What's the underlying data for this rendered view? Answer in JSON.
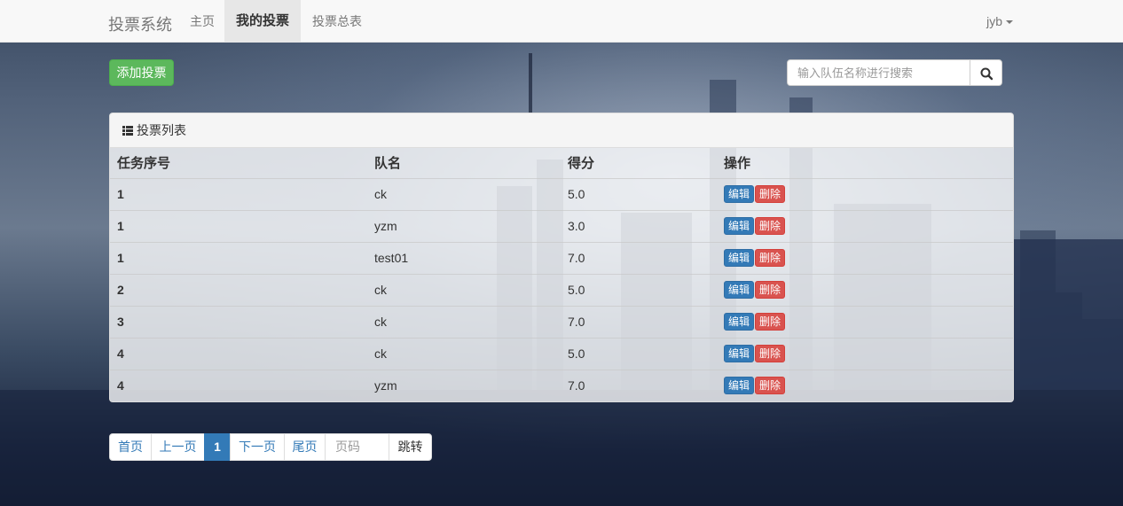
{
  "navbar": {
    "brand": "投票系统",
    "links": [
      "主页",
      "我的投票",
      "投票总表"
    ],
    "user": "jyb"
  },
  "toolbar": {
    "add_label": "添加投票",
    "search_placeholder": "输入队伍名称进行搜索"
  },
  "panel": {
    "title": "投票列表",
    "columns": [
      "任务序号",
      "队名",
      "得分",
      "操作"
    ],
    "rows": [
      {
        "seq": "1",
        "team": "ck",
        "score": "5.0"
      },
      {
        "seq": "1",
        "team": "yzm",
        "score": "3.0"
      },
      {
        "seq": "1",
        "team": "test01",
        "score": "7.0"
      },
      {
        "seq": "2",
        "team": "ck",
        "score": "5.0"
      },
      {
        "seq": "3",
        "team": "ck",
        "score": "7.0"
      },
      {
        "seq": "4",
        "team": "ck",
        "score": "5.0"
      },
      {
        "seq": "4",
        "team": "yzm",
        "score": "7.0"
      }
    ],
    "edit_label": "编辑",
    "delete_label": "删除"
  },
  "pagination": {
    "first": "首页",
    "prev": "上一页",
    "current": "1",
    "next": "下一页",
    "last": "尾页",
    "page_placeholder": "页码",
    "go": "跳转"
  },
  "colors": {
    "primary": "#337ab7",
    "success": "#5cb85c",
    "danger": "#d9534f"
  }
}
